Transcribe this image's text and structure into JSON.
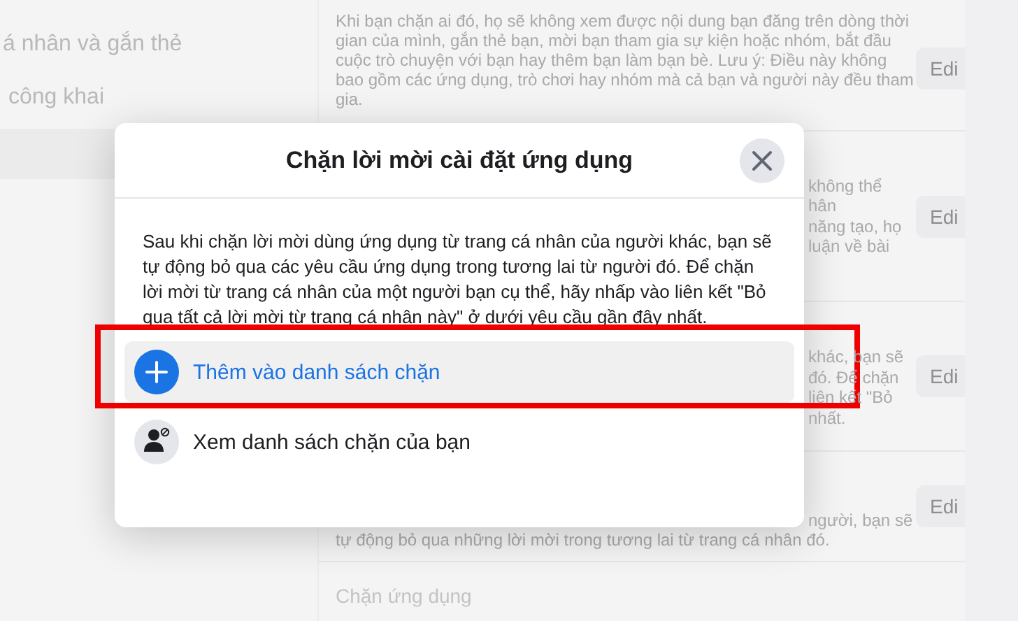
{
  "sidebar": {
    "items": [
      {
        "label": "á nhân và gắn thẻ",
        "selected": false
      },
      {
        "label": "công khai",
        "selected": false
      },
      {
        "selected": true
      }
    ]
  },
  "sections": [
    {
      "kind": "full",
      "lines": [
        {
          "kind": "full",
          "text": "Khi bạn chặn ai đó, họ sẽ không xem được nội dung bạn đăng trên dòng thời gian của mình, gắn thẻ bạn, mời bạn tham gia sự kiện hoặc nhóm, bắt đầu cuộc trò chuyện với bạn hay thêm bạn làm bạn bè. Lưu ý: Điều này không bao gồm các ứng dụng, trò chơi hay nhóm mà cả bạn và người này đều tham gia."
        }
      ],
      "edit": "Edi"
    },
    {
      "kind": "covered",
      "lines": [
        {
          "kind": "tail",
          "text": "không thể"
        },
        {
          "kind": "tail",
          "text": "hân"
        },
        {
          "kind": "tail",
          "text": "năng tạo, họ"
        },
        {
          "kind": "tail",
          "text": "luận về bài"
        }
      ],
      "edit": "Edi"
    },
    {
      "kind": "covered",
      "lines": [
        {
          "kind": "tail",
          "text": "khác, bạn sẽ"
        },
        {
          "kind": "tail",
          "text": "đó. Để chặn"
        },
        {
          "kind": "tail",
          "text": "liên kết \"Bỏ"
        },
        {
          "kind": "tail",
          "text": "nhất."
        }
      ],
      "edit": "Edi"
    },
    {
      "kind": "covered",
      "lines": [
        {
          "kind": "tail",
          "text": "người, bạn sẽ"
        },
        {
          "kind": "full",
          "text": "tự động bỏ qua những lời mời trong tương lai từ trang cá nhân đó."
        }
      ],
      "edit": "Edi"
    },
    {
      "kind": "bottom",
      "heading": "Chặn ứng dụng"
    }
  ],
  "dialog": {
    "title": "Chặn lời mời cài đặt ứng dụng",
    "body": "Sau khi chặn lời mời dùng ứng dụng từ trang cá nhân của người khác, bạn sẽ tự động bỏ qua các yêu cầu ứng dụng trong tương lai từ người đó. Để chặn lời mời từ trang cá nhân của một người bạn cụ thể, hãy nhấp vào liên kết \"Bỏ qua tất cả lời mời từ trang cá nhân này\" ở dưới yêu cầu gần đây nhất.",
    "actions": [
      {
        "kind": "add",
        "label": "Thêm vào danh sách chặn",
        "selected": true,
        "highlighted": true
      },
      {
        "kind": "list",
        "label": "Xem danh sách chặn của bạn",
        "selected": false,
        "highlighted": false
      }
    ]
  }
}
